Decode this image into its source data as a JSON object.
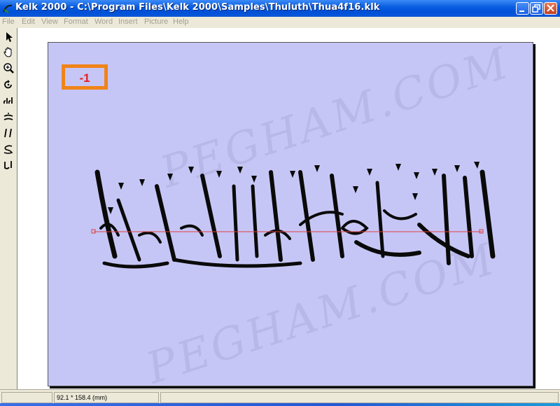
{
  "window": {
    "title": "Kelk 2000 - C:\\Program Files\\Kelk 2000\\Samples\\Thuluth\\Thua4f16.klk",
    "controls": [
      "minimize",
      "maximize",
      "close"
    ]
  },
  "menu": {
    "items": [
      {
        "label": "File"
      },
      {
        "label": "Edit"
      },
      {
        "label": "View"
      },
      {
        "label": "Format"
      },
      {
        "label": "Word"
      },
      {
        "label": "Insert"
      },
      {
        "label": "Picture"
      },
      {
        "label": "Help"
      }
    ]
  },
  "toolbar": {
    "tools": [
      {
        "icon": "arrow-pointer-icon"
      },
      {
        "icon": "hand-icon"
      },
      {
        "icon": "zoom-icon"
      },
      {
        "icon": "rotate-icon"
      },
      {
        "icon": "arabic-letters-icon"
      },
      {
        "icon": "arabic-stroke-icon"
      },
      {
        "icon": "arabic-pair-icon"
      },
      {
        "icon": "arabic-curve-icon"
      },
      {
        "icon": "arabic-word-icon"
      }
    ]
  },
  "canvas": {
    "badge": "-1",
    "watermark": "PEGHAM.COM",
    "calligraphy_text": "إن الدين عند الله الإسلام",
    "colors": {
      "paper": "#c6c6f6",
      "badge_border": "#f08418",
      "badge_text": "#e32020",
      "baseline": "#e04040"
    }
  },
  "status": {
    "left": "",
    "dimensions": "92.1 * 158.4 (mm)",
    "right": ""
  }
}
